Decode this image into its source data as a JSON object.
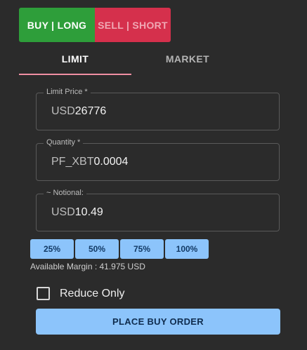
{
  "side_toggle": {
    "buy_label": "BUY | LONG",
    "sell_label": "SELL | SHORT"
  },
  "tabs": {
    "limit": "LIMIT",
    "market": "MARKET"
  },
  "fields": {
    "limit_price": {
      "label": "Limit Price *",
      "prefix": "USD",
      "value": "26776"
    },
    "quantity": {
      "label": "Quantity *",
      "prefix": "PF_XBT",
      "value": "0.0004"
    },
    "notional": {
      "label": "~ Notional:",
      "prefix": "USD",
      "value": "10.49"
    }
  },
  "percent_buttons": [
    "25%",
    "50%",
    "75%",
    "100%"
  ],
  "available_margin": "Available Margin : 41.975 USD",
  "reduce_only": {
    "label": "Reduce Only",
    "checked": false
  },
  "place_order_label": "PLACE BUY ORDER",
  "colors": {
    "background": "#2b2b2b",
    "buy": "#2e9e3a",
    "sell": "#d5304c",
    "accent": "#8cc4fb",
    "tab_indicator": "#f08fa3"
  }
}
